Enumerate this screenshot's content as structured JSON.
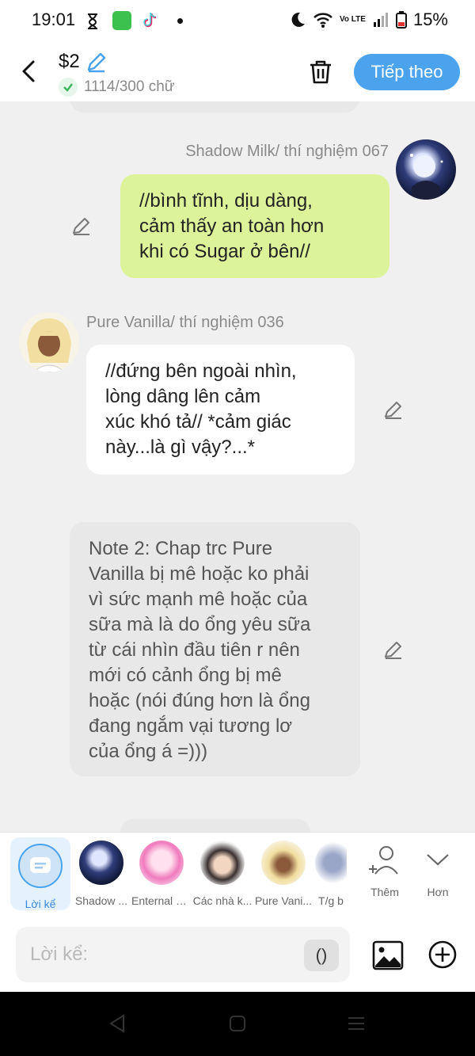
{
  "status_bar": {
    "time": "19:01",
    "battery": "15%",
    "network": "Vo LTE"
  },
  "header": {
    "title": "$2",
    "counter": "1114/300 chữ",
    "next_label": "Tiếp theo"
  },
  "messages": [
    {
      "sender": "Shadow Milk/ thí nghiệm 067",
      "text_lines": [
        "//bình tĩnh, dịu dàng,",
        "cảm thấy an toàn hơn",
        "khi có Sugar ở bên//"
      ],
      "side": "right"
    },
    {
      "sender": "Pure Vanilla/ thí nghiệm 036",
      "text_lines": [
        "//đứng bên ngoài nhìn,",
        "lòng dâng lên cảm",
        "xúc khó tả// *cảm giác",
        "này...là gì vậy?...*"
      ],
      "side": "left"
    },
    {
      "sender": "",
      "text_lines": [
        "Note 2: Chap trc Pure",
        "Vanilla bị mê hoặc ko phải",
        "vì sức mạnh mê hoặc của",
        "sữa mà là do ổng yêu sữa",
        "từ cái nhìn đầu tiên r nên",
        "mới có cảnh ổng bị mê",
        "hoặc (nói đúng hơn là ổng",
        "đang ngắm vại tương lơ",
        "của ổng á =)))"
      ],
      "side": "narration"
    }
  ],
  "characters": [
    {
      "name": "Lời kể",
      "active": true
    },
    {
      "name": "Shadow ...",
      "active": false
    },
    {
      "name": "Enternal S...",
      "active": false
    },
    {
      "name": "Các nhà k...",
      "active": false
    },
    {
      "name": "Pure Vani...",
      "active": false
    },
    {
      "name": "T/g b",
      "active": false
    }
  ],
  "char_actions": {
    "add_label": "Thêm",
    "more_label": "Hơn"
  },
  "composer": {
    "placeholder": "Lời kể:",
    "paren_label": "()"
  },
  "colors": {
    "accent": "#4aa3ec",
    "green_bubble": "#dcf39a",
    "narration_bubble": "#e8e8e8"
  }
}
